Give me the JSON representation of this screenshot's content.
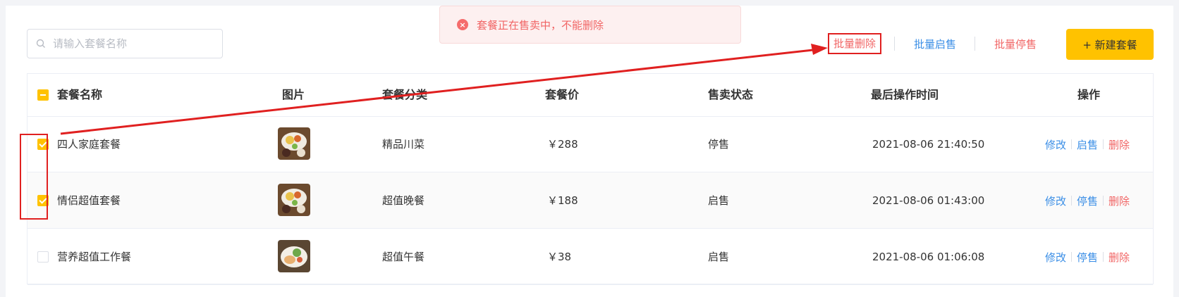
{
  "search": {
    "placeholder": "请输入套餐名称"
  },
  "alert": {
    "message": "套餐正在售卖中，不能删除",
    "icon": "error-circle-icon"
  },
  "toolbar": {
    "batch_delete": "批量删除",
    "batch_start": "批量启售",
    "batch_stop": "批量停售",
    "new_button": "+ 新建套餐"
  },
  "table": {
    "headers": {
      "name": "套餐名称",
      "image": "图片",
      "category": "套餐分类",
      "price": "套餐价",
      "status": "售卖状态",
      "time": "最后操作时间",
      "ops": "操作"
    },
    "rows": [
      {
        "name": "四人家庭套餐",
        "category": "精品川菜",
        "price": "￥288",
        "status": "停售",
        "time": "2021-08-06 21:40:50",
        "op_edit": "修改",
        "op_toggle": "启售",
        "op_delete": "删除",
        "checked": true
      },
      {
        "name": "情侣超值套餐",
        "category": "超值晚餐",
        "price": "￥188",
        "status": "启售",
        "time": "2021-08-06 01:43:00",
        "op_edit": "修改",
        "op_toggle": "停售",
        "op_delete": "删除",
        "checked": true
      },
      {
        "name": "营养超值工作餐",
        "category": "超值午餐",
        "price": "￥38",
        "status": "启售",
        "time": "2021-08-06 01:06:08",
        "op_edit": "修改",
        "op_toggle": "停售",
        "op_delete": "删除",
        "checked": false
      }
    ]
  },
  "colors": {
    "accent": "#ffc200",
    "link_blue": "#3a8ee6",
    "danger": "#f16565",
    "annotation": "#e02020"
  }
}
